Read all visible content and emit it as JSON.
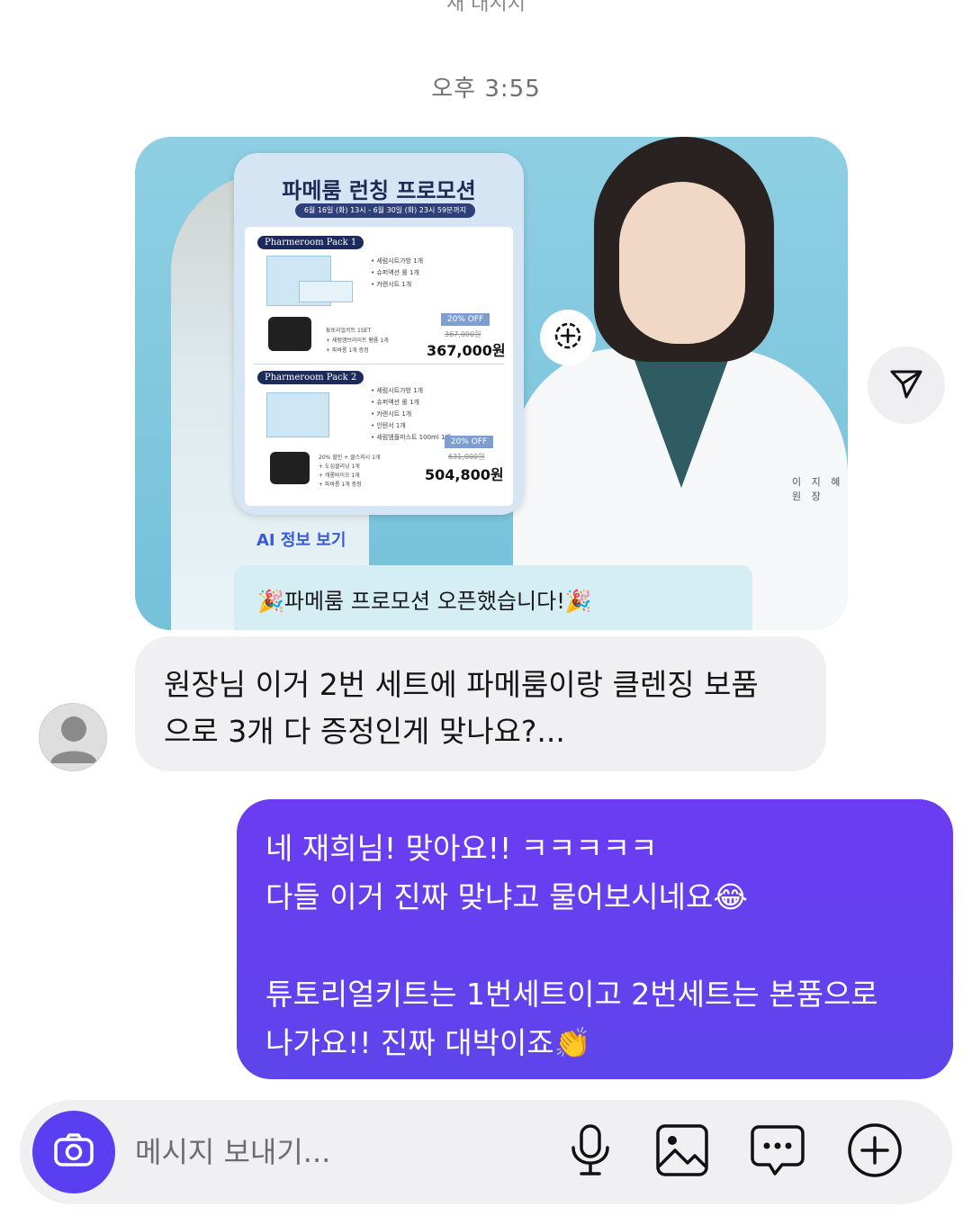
{
  "header": {
    "partial_label": "새 대시지"
  },
  "timestamp": "오후 3:55",
  "shared_post": {
    "promo_title": "파메룸 런칭 프로모션",
    "promo_period": "6월 16일 (화) 13시 - 6월 30일 (화) 23시 59분까지",
    "pack1": {
      "name": "Pharmeroom Pack 1",
      "items": [
        "세럼시트가방 1개",
        "슈퍼액션 롤 1개",
        "카렌시트 1개"
      ],
      "extra_items": [
        "튜토리얼키트 1SET",
        "+ 세럼앰브라이트 팸퓸 1개",
        "+ 파바롱 1개 증정"
      ],
      "discount": "20% OFF",
      "original_price": "367,000원",
      "price": "367,000원"
    },
    "pack2": {
      "name": "Pharmeroom Pack 2",
      "items": [
        "세럼시트가방 1개",
        "슈퍼액션 롤 1개",
        "카렌시트 1개",
        "인텐서 1개",
        "세럼앰플미스트 100ml 1개"
      ],
      "extra_items": [
        "20% 할인 + 클스지시 1개",
        "+ 도심클리닝 1개",
        "+ 캐롬바이오 1개",
        "+ 파바롱 1개 증정"
      ],
      "discount": "20% OFF",
      "original_price": "631,000원",
      "price": "504,800원"
    },
    "name_tag": "이 지 혜 원 장",
    "ai_link": "AI 정보 보기",
    "caption": "파메룸 프로모션 오픈했습니다!"
  },
  "messages": {
    "incoming": {
      "line1": "원장님 이거 2번 세트에 파메룸이랑 클렌징 보품",
      "line2": "으로 3개 다 증정인게 맞나요?..."
    },
    "outgoing": {
      "line1": "네 재희님! 맞아요!! ㅋㅋㅋㅋㅋ",
      "line2": "다들 이거 진짜 맞냐고 물어보시네요",
      "line3": "튜토리얼키트는 1번세트이고 2번세트는 본품으로",
      "line4": "나가요!! 진짜 대박이죠",
      "emoji1": "😂",
      "emoji2": "👏"
    }
  },
  "composer": {
    "placeholder": "메시지 보내기...",
    "icons": [
      "camera-icon",
      "microphone-icon",
      "image-icon",
      "chat-bubble-icon",
      "plus-circle-icon"
    ]
  },
  "colors": {
    "accent": "#5a3ff2",
    "outgoing_bubble": "#6b3cf2",
    "incoming_bubble": "#f0f0f2",
    "link": "#3a5ad8"
  }
}
